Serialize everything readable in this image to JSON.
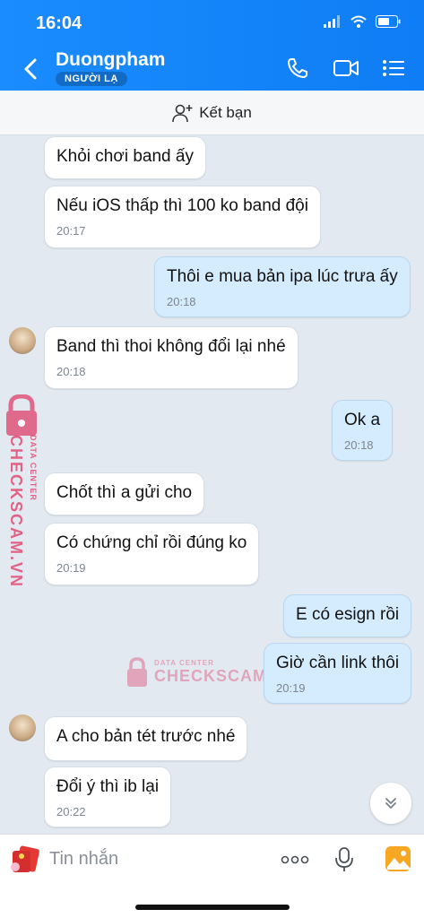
{
  "status_bar": {
    "time": "16:04"
  },
  "header": {
    "contact_name": "Duongpham",
    "badge": "NGƯỜI LẠ"
  },
  "friend_bar": {
    "label": "Kết bạn"
  },
  "messages": [
    {
      "side": "in",
      "text": "Khỏi chơi band ấy",
      "time": ""
    },
    {
      "side": "in",
      "text": "Nếu iOS thấp thì 100 ko band đội",
      "time": "20:17"
    },
    {
      "side": "out",
      "text": "Thôi e mua bản ipa lúc trưa ấy",
      "time": "20:18"
    },
    {
      "side": "in",
      "text": "Band thì thoi không đổi lại nhé",
      "time": "20:18"
    },
    {
      "side": "out",
      "text": "Ok a",
      "time": "20:18"
    },
    {
      "side": "in",
      "text": "Chốt thì a gửi cho",
      "time": ""
    },
    {
      "side": "in",
      "text": "Có chứng chỉ rồi đúng ko",
      "time": "20:19"
    },
    {
      "side": "out",
      "text": "E có esign rồi",
      "time": ""
    },
    {
      "side": "out",
      "text": "Giờ cần link thôi",
      "time": "20:19"
    },
    {
      "side": "in",
      "text": "A cho bản tét trước nhé",
      "time": ""
    },
    {
      "side": "in",
      "text": "Đổi ý thì ib lại",
      "time": "20:22"
    }
  ],
  "input": {
    "placeholder": "Tin nhắn"
  },
  "watermark": {
    "brand": "CHECKSCAM.VN",
    "tagline": "DATA CENTER"
  },
  "icons": {
    "back": "chevron-left-icon",
    "call": "phone-icon",
    "video": "video-camera-icon",
    "menu": "list-icon",
    "add_friend": "add-user-icon",
    "scroll": "double-chevron-down-icon",
    "sticker": "sticker-icon",
    "more": "more-dots-icon",
    "mic": "microphone-icon",
    "image": "image-icon"
  },
  "colors": {
    "header": "#1a8cff",
    "outgoing_bubble": "#d5ecfe",
    "incoming_bubble": "#ffffff",
    "chat_bg": "#e2e9f1"
  }
}
